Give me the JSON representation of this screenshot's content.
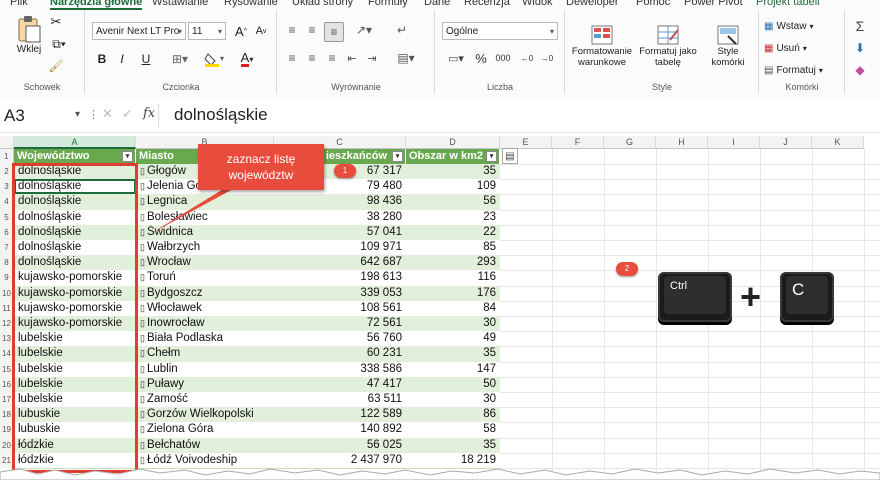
{
  "tabs": [
    "Plik",
    "Narzędzia główne",
    "Wstawianie",
    "Rysowanie",
    "Układ strony",
    "Formuły",
    "Dane",
    "Recenzja",
    "Widok",
    "Deweloper",
    "Pomoc",
    "Power Pivot",
    "Projekt tabeli"
  ],
  "ribbon": {
    "clipboard": {
      "label": "Schowek",
      "paste": "Wklej"
    },
    "font": {
      "label": "Czcionka",
      "font_name": "Avenir Next LT Pro",
      "font_size": "11",
      "bold": "B",
      "italic": "I",
      "underline": "U",
      "grow": "A",
      "shrink": "A",
      "font_color": "A"
    },
    "alignment": {
      "label": "Wyrównanie"
    },
    "number": {
      "label": "Liczba",
      "format": "Ogólne",
      "percent": "%",
      "thousands": "000"
    },
    "styles": {
      "label": "Style",
      "conditional": "Formatowanie warunkowe",
      "conditional_l1": "Formatowanie",
      "conditional_l2": "warunkowe",
      "as_table_l1": "Formatuj jako",
      "as_table_l2": "tabelę",
      "cell_styles_l1": "Style",
      "cell_styles_l2": "komórki"
    },
    "cells": {
      "label": "Komórki",
      "insert": "Wstaw",
      "delete": "Usuń",
      "format": "Formatuj"
    },
    "editing": {
      "sum": "Σ"
    }
  },
  "formula_bar": {
    "name_box": "A3",
    "fx": "fx",
    "value": "dolnośląskie"
  },
  "columns": [
    "A",
    "B",
    "C",
    "D",
    "E",
    "F",
    "G",
    "H",
    "I",
    "J",
    "K"
  ],
  "table": {
    "headers": [
      "Województwo",
      "Miasto",
      "Liczba mieszkańców",
      "Obszar w km2"
    ],
    "header_c_visible": "ieszkańców",
    "rows": [
      [
        "dolnośląskie",
        "Głogów",
        "67 317",
        "35"
      ],
      [
        "dolnośląskie",
        "Jelenia Góra",
        "79 480",
        "109"
      ],
      [
        "dolnośląskie",
        "Legnica",
        "98 436",
        "56"
      ],
      [
        "dolnośląskie",
        "Bolesławiec",
        "38 280",
        "23"
      ],
      [
        "dolnośląskie",
        "Świdnica",
        "57 041",
        "22"
      ],
      [
        "dolnośląskie",
        "Wałbrzych",
        "109 971",
        "85"
      ],
      [
        "dolnośląskie",
        "Wrocław",
        "642 687",
        "293"
      ],
      [
        "kujawsko-pomorskie",
        "Toruń",
        "198 613",
        "116"
      ],
      [
        "kujawsko-pomorskie",
        "Bydgoszcz",
        "339 053",
        "176"
      ],
      [
        "kujawsko-pomorskie",
        "Włocławek",
        "108 561",
        "84"
      ],
      [
        "kujawsko-pomorskie",
        "Inowrocław",
        "72 561",
        "30"
      ],
      [
        "lubelskie",
        "Biała Podlaska",
        "56 760",
        "49"
      ],
      [
        "lubelskie",
        "Chełm",
        "60 231",
        "35"
      ],
      [
        "lubelskie",
        "Lublin",
        "338 586",
        "147"
      ],
      [
        "lubelskie",
        "Puławy",
        "47 417",
        "50"
      ],
      [
        "lubelskie",
        "Zamość",
        "63 511",
        "30"
      ],
      [
        "lubuskie",
        "Gorzów Wielkopolski",
        "122 589",
        "86"
      ],
      [
        "lubuskie",
        "Zielona Góra",
        "140 892",
        "58"
      ],
      [
        "łódzkie",
        "Bełchatów",
        "56 025",
        "35"
      ],
      [
        "łódzkie",
        "Łódź Voivodeship",
        "2 437 970",
        "18 219"
      ]
    ],
    "row_numbers": [
      "1",
      "2",
      "3",
      "4",
      "5",
      "6",
      "7",
      "8",
      "9",
      "10",
      "11",
      "12",
      "13",
      "14",
      "15",
      "16",
      "17",
      "18",
      "19",
      "20",
      "21"
    ]
  },
  "callout": {
    "text_l1": "zaznacz listę",
    "text_l2": "województw",
    "badge": "1"
  },
  "shortcut": {
    "badge": "2",
    "key1": "Ctrl",
    "plus": "+",
    "key2": "C"
  },
  "colors": {
    "accent": "#1e6b3b",
    "header_green": "#6aa84f",
    "band_green": "#e2efda",
    "callout_red": "#e74c3c",
    "selection_red": "#e03c31"
  }
}
